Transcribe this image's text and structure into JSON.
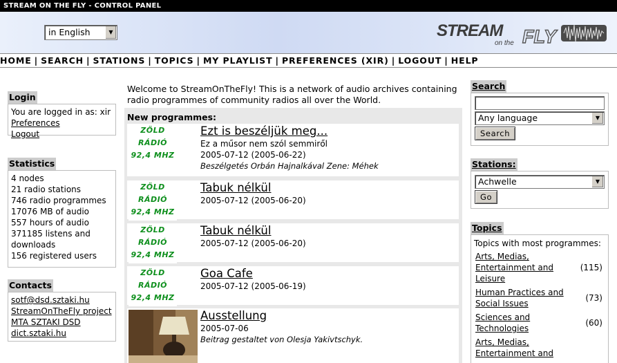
{
  "window": {
    "title": "STREAM ON THE FLY - CONTROL PANEL"
  },
  "header": {
    "language_select": {
      "value": "in English"
    },
    "logo": {
      "text_main": "STREAM",
      "text_sub": "on the",
      "text_fly": "FLY"
    }
  },
  "nav": {
    "items": [
      "HOME",
      "SEARCH",
      "STATIONS",
      "TOPICS",
      "MY PLAYLIST",
      "PREFERENCES (XIR)",
      "LOGOUT",
      "HELP"
    ],
    "separator": "|"
  },
  "login": {
    "title": "Login",
    "logged_in_text": "You are logged in as: xir",
    "preferences_link": "Preferences",
    "logout_link": "Logout"
  },
  "statistics": {
    "title": "Statistics",
    "lines": [
      "4 nodes",
      "21 radio stations",
      "746 radio programmes",
      "17076 MB of audio",
      "557 hours of audio",
      "371185 listens and downloads",
      "156 registered users"
    ]
  },
  "contacts": {
    "title": "Contacts",
    "links": [
      "sotf@dsd.sztaki.hu",
      "StreamOnTheFly project",
      "MTA SZTAKI DSD",
      "dict.sztaki.hu"
    ]
  },
  "main": {
    "welcome": "Welcome to StreamOnTheFly! This is a network of audio archives containing radio programmes of community radios all over the World.",
    "new_programmes_title": "New programmes:",
    "station_thumb": {
      "line1": "ZÖLD",
      "line2": "RÁDIÓ",
      "line3": "92,4 MHZ"
    },
    "programmes": [
      {
        "title": "Ezt is beszéljük meg...",
        "subtitle": "Ez a műsor nem szól semmiről",
        "date": "2005-07-12 (2005-06-22)",
        "description": "Beszélgetés Orbán Hajnalkával Zene: Méhek"
      },
      {
        "title": "Tabuk nélkül",
        "date": "2005-07-12 (2005-06-20)"
      },
      {
        "title": "Tabuk nélkül",
        "date": "2005-07-12 (2005-06-20)"
      },
      {
        "title": "Goa Cafe",
        "date": "2005-07-12 (2005-06-19)"
      },
      {
        "title": "Ausstellung",
        "date": "2005-07-06",
        "description": "Beitrag gestaltet von Olesja Yakivtschyk."
      }
    ]
  },
  "search": {
    "title": "Search",
    "input_value": "",
    "language_select": "Any language",
    "button": "Search"
  },
  "stations": {
    "title": "Stations:",
    "select_value": "Achwelle",
    "button": "Go"
  },
  "topics": {
    "title": "Topics",
    "intro": "Topics with most programmes:",
    "items": [
      {
        "name": "Arts, Medias, Entertainment and Leisure",
        "count": "(115)"
      },
      {
        "name": "Human Practices and Social Issues",
        "count": "(73)"
      },
      {
        "name": "Sciences and Technologies",
        "count": "(60)"
      },
      {
        "name": "Arts, Medias, Entertainment and",
        "count": ""
      }
    ]
  },
  "colors": {
    "title_bar": "#000000",
    "station_logo_green": "#0d8f1c",
    "box_title_bg": "#cccccc",
    "panel_bg": "#e8e8e8"
  }
}
